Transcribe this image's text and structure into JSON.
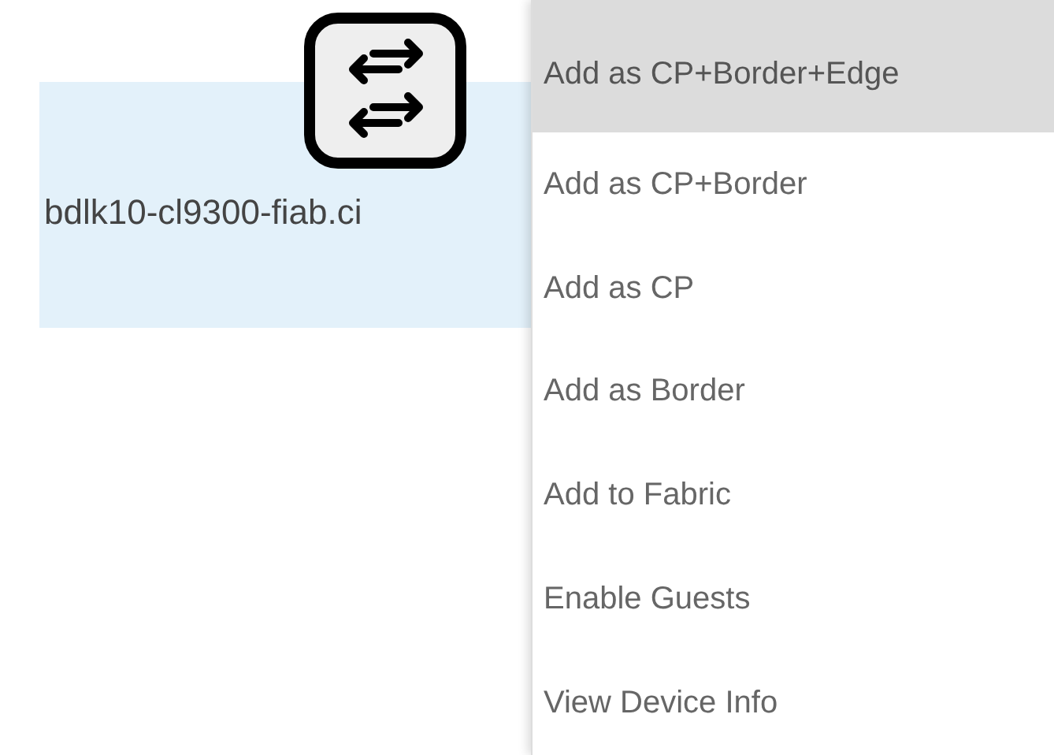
{
  "device": {
    "label": "bdlk10-cl9300-fiab.ci"
  },
  "menu": {
    "items": [
      {
        "label": "Add as CP+Border+Edge",
        "selected": true
      },
      {
        "label": "Add as CP+Border",
        "selected": false
      },
      {
        "label": "Add as CP",
        "selected": false
      },
      {
        "label": "Add as Border",
        "selected": false
      },
      {
        "label": "Add to Fabric",
        "selected": false
      },
      {
        "label": "Enable Guests",
        "selected": false
      },
      {
        "label": "View Device Info",
        "selected": false
      }
    ]
  }
}
